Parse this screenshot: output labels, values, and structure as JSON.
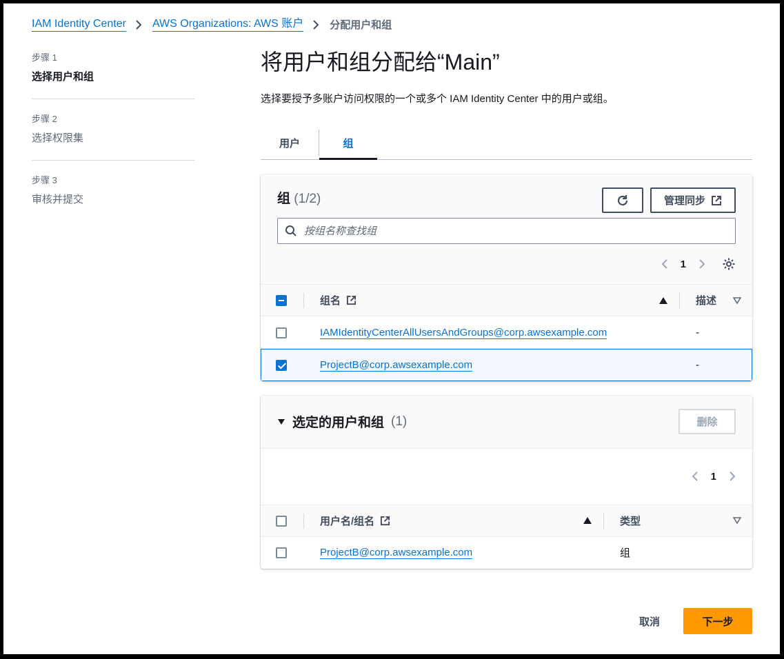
{
  "breadcrumb": {
    "items": [
      "IAM Identity Center",
      "AWS Organizations: AWS 账户"
    ],
    "current": "分配用户和组"
  },
  "steps": [
    {
      "num": "步骤 1",
      "name": "选择用户和组"
    },
    {
      "num": "步骤 2",
      "name": "选择权限集"
    },
    {
      "num": "步骤 3",
      "name": "审核并提交"
    }
  ],
  "page": {
    "title": "将用户和组分配给“Main”",
    "description": "选择要授予多账户访问权限的一个或多个 IAM Identity Center 中的用户或组。"
  },
  "tabs": {
    "users": "用户",
    "groups": "组"
  },
  "groups_panel": {
    "title": "组",
    "count": "(1/2)",
    "manage_sync_label": "管理同步",
    "search_placeholder": "按组名称查找组",
    "page_number": "1",
    "columns": {
      "name": "组名",
      "description": "描述"
    },
    "rows": [
      {
        "name": "IAMIdentityCenterAllUsersAndGroups@corp.awsexample.com",
        "description": "-"
      },
      {
        "name": "ProjectB@corp.awsexample.com",
        "description": "-"
      }
    ]
  },
  "selected_panel": {
    "title": "选定的用户和组",
    "count": "(1)",
    "remove_label": "删除",
    "page_number": "1",
    "columns": {
      "name": "用户名/组名",
      "type": "类型"
    },
    "rows": [
      {
        "name": "ProjectB@corp.awsexample.com",
        "type": "组"
      }
    ]
  },
  "footer": {
    "cancel": "取消",
    "next": "下一步"
  },
  "colors": {
    "accent": "#0972d3",
    "primary": "#ff9900"
  }
}
